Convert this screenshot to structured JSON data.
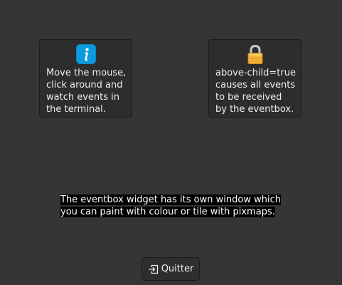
{
  "info_frame": {
    "icon": "info-icon",
    "text": "Move the mouse,\nclick around and\nwatch events in\nthe terminal."
  },
  "lock_frame": {
    "icon": "lock-icon",
    "text": "above-child=true\ncauses all events\nto be received\nby the eventbox."
  },
  "caption": {
    "line1": "The eventbox widget has its own window which",
    "line2": "you can paint with colour or tile with pixmaps."
  },
  "quit_button": {
    "icon": "exit-icon",
    "label": "Quitter"
  },
  "colors": {
    "background": "#353535",
    "info_blue": "#0d9be0",
    "lock_gold": "#f3b23a"
  }
}
